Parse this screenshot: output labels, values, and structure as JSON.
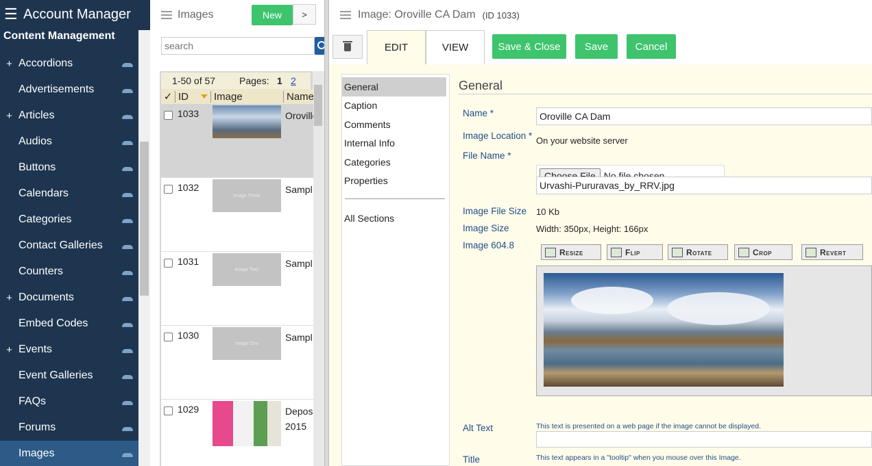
{
  "sidebar": {
    "app_title": "Account Manager",
    "section_title": "Content Management",
    "items": [
      {
        "label": "Accordions",
        "expandable": "+"
      },
      {
        "label": "Advertisements",
        "expandable": ""
      },
      {
        "label": "Articles",
        "expandable": "+"
      },
      {
        "label": "Audios",
        "expandable": ""
      },
      {
        "label": "Buttons",
        "expandable": ""
      },
      {
        "label": "Calendars",
        "expandable": ""
      },
      {
        "label": "Categories",
        "expandable": ""
      },
      {
        "label": "Contact Galleries",
        "expandable": ""
      },
      {
        "label": "Counters",
        "expandable": ""
      },
      {
        "label": "Documents",
        "expandable": "+"
      },
      {
        "label": "Embed Codes",
        "expandable": ""
      },
      {
        "label": "Events",
        "expandable": "+"
      },
      {
        "label": "Event Galleries",
        "expandable": ""
      },
      {
        "label": "FAQs",
        "expandable": ""
      },
      {
        "label": "Forums",
        "expandable": ""
      },
      {
        "label": "Images",
        "expandable": ""
      }
    ]
  },
  "list": {
    "title": "Images",
    "new_label": "New",
    "next_label": ">",
    "search_placeholder": "search",
    "range": "1-50 of 57",
    "pages_label": "Pages:",
    "page1": "1",
    "page2": "2",
    "columns": {
      "check": "✓",
      "id": "ID",
      "image": "Image",
      "name": "Name"
    },
    "rows": [
      {
        "id": "1033",
        "name": "Oroville",
        "thumb": "photo",
        "thumb_text": ""
      },
      {
        "id": "1032",
        "name": "Sampl",
        "thumb": "sample",
        "thumb_text": "Image Three"
      },
      {
        "id": "1031",
        "name": "Sampl",
        "thumb": "sample",
        "thumb_text": "Image Two"
      },
      {
        "id": "1030",
        "name": "Sampl",
        "thumb": "sample",
        "thumb_text": "Image One"
      },
      {
        "id": "1029",
        "name": "Depos",
        "name2": "2015",
        "thumb": "desk",
        "thumb_text": ""
      }
    ]
  },
  "editor": {
    "title": "Image: Oroville CA Dam",
    "id_tag": "(ID 1033)",
    "tabs": {
      "edit": "EDIT",
      "view": "VIEW"
    },
    "buttons": {
      "save_close": "Save & Close",
      "save": "Save",
      "cancel": "Cancel"
    },
    "nav": [
      "General",
      "Caption",
      "Comments",
      "Internal Info",
      "Categories",
      "Properties"
    ],
    "nav_all": "All Sections",
    "section_title": "General",
    "fields": {
      "name_label": "Name *",
      "name_value": "Oroville CA Dam",
      "location_label": "Image Location *",
      "location_value": "On your website server",
      "filename_label": "File Name *",
      "choose_file": "Choose File",
      "no_file": "No file chosen",
      "filename_value": "Urvashi-Pururavas_by_RRV.jpg",
      "filesize_label": "Image File Size",
      "filesize_value": "10 Kb",
      "imgsize_label": "Image Size",
      "imgsize_value": "Width: 350px, Height: 166px",
      "image_label": "Image 604.8",
      "tools": [
        "Resize",
        "Flip",
        "Rotate",
        "Crop",
        "Revert"
      ],
      "alt_label": "Alt Text",
      "alt_help": "This text is presented on a web page if the image cannot be displayed.",
      "title_label": "Title",
      "title_help": "This text appears in a \"tooltip\" when you mouse over this Image."
    }
  }
}
